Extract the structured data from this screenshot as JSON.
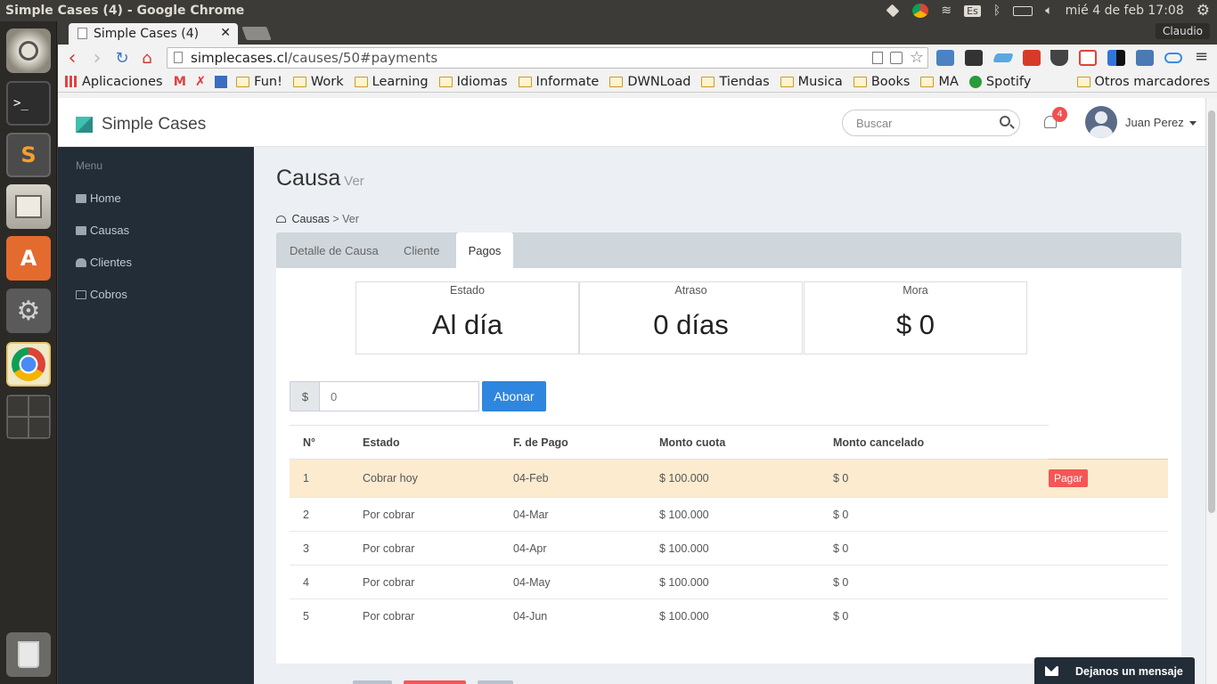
{
  "os": {
    "window_title": "Simple Cases (4) - Google Chrome",
    "clock": "mié  4 de feb 17:08",
    "keyboard_layout": "Es"
  },
  "browser": {
    "tab_title": "Simple Cases (4)",
    "tab_close": "✕",
    "profile": "Claudio",
    "url_host": "simplecases.cl",
    "url_path": "/causes/50#payments",
    "bookmarks": [
      {
        "label": "Aplicaciones",
        "type": "apps"
      },
      {
        "label": "Fun!",
        "type": "folder"
      },
      {
        "label": "Work",
        "type": "folder"
      },
      {
        "label": "Learning",
        "type": "folder"
      },
      {
        "label": "Idiomas",
        "type": "folder"
      },
      {
        "label": "Informate",
        "type": "folder"
      },
      {
        "label": "DWNLoad",
        "type": "folder"
      },
      {
        "label": "Tiendas",
        "type": "folder"
      },
      {
        "label": "Musica",
        "type": "folder"
      },
      {
        "label": "Books",
        "type": "folder"
      },
      {
        "label": "MA",
        "type": "folder"
      },
      {
        "label": "Spotify",
        "type": "link"
      }
    ],
    "other_bookmarks": "Otros marcadores"
  },
  "app": {
    "brand": "Simple Cases",
    "search_placeholder": "Buscar",
    "notifications": "4",
    "user_name": "Juan Perez",
    "menu_header": "Menu",
    "menu": [
      "Home",
      "Causas",
      "Clientes",
      "Cobros"
    ],
    "page_title": "Causa",
    "page_subtitle": "Ver",
    "breadcrumb": {
      "parent": "Causas",
      "sep": ">",
      "current": "Ver"
    },
    "tabs": [
      "Detalle de Causa",
      "Cliente",
      "Pagos"
    ],
    "active_tab": "Pagos",
    "stats": [
      {
        "label": "Estado",
        "value": "Al día"
      },
      {
        "label": "Atraso",
        "value": "0 días"
      },
      {
        "label": "Mora",
        "value": "$ 0"
      }
    ],
    "currency_symbol": "$",
    "amount_value": "0",
    "abonar_label": "Abonar",
    "table": {
      "headers": [
        "N°",
        "Estado",
        "F. de Pago",
        "Monto cuota",
        "Monto cancelado"
      ],
      "rows": [
        {
          "n": "1",
          "estado": "Cobrar hoy",
          "fecha": "04-Feb",
          "cuota": "$ 100.000",
          "cancelado": "$ 0",
          "action": "Pagar"
        },
        {
          "n": "2",
          "estado": "Por cobrar",
          "fecha": "04-Mar",
          "cuota": "$ 100.000",
          "cancelado": "$ 0"
        },
        {
          "n": "3",
          "estado": "Por cobrar",
          "fecha": "04-Apr",
          "cuota": "$ 100.000",
          "cancelado": "$ 0"
        },
        {
          "n": "4",
          "estado": "Por cobrar",
          "fecha": "04-May",
          "cuota": "$ 100.000",
          "cancelado": "$ 0"
        },
        {
          "n": "5",
          "estado": "Por cobrar",
          "fecha": "04-Jun",
          "cuota": "$ 100.000",
          "cancelado": "$ 0"
        }
      ]
    },
    "chat_label": "Dejanos un mensaje"
  },
  "colors": {
    "sidebar": "#232d38",
    "primary_button": "#2f86de",
    "danger_button": "#f45656",
    "highlight_row": "#fcebcf"
  }
}
